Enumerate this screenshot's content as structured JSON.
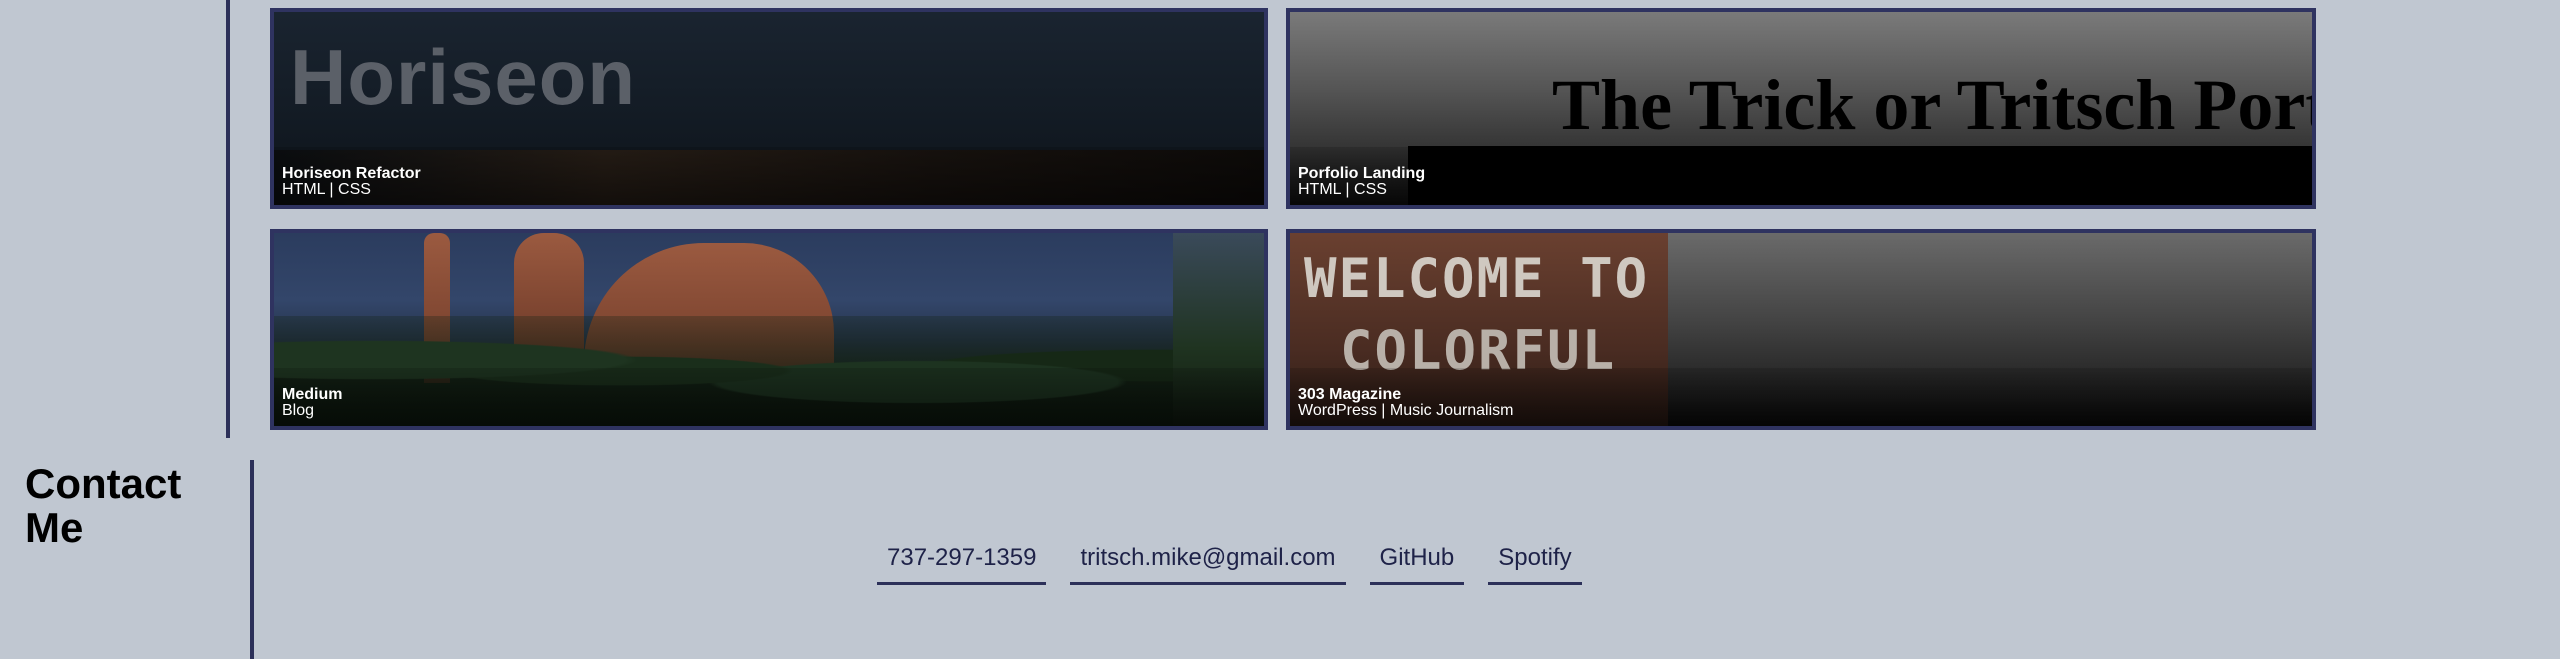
{
  "projects": [
    {
      "title": "Horiseon Refactor",
      "tags": "HTML | CSS",
      "thumb_text": "Horiseon"
    },
    {
      "title": "Porfolio Landing",
      "tags": "HTML | CSS",
      "thumb_text": "The Trick or Tritsch Port"
    },
    {
      "title": "Medium",
      "tags": "Blog"
    },
    {
      "title": "303 Magazine",
      "tags": "WordPress | Music Journalism",
      "thumb_text_line1": "WELCOME TO",
      "thumb_text_line2": "COLORFUL"
    }
  ],
  "contact": {
    "heading": "Contact Me",
    "links": [
      {
        "label": "737-297-1359"
      },
      {
        "label": "tritsch.mike@gmail.com"
      },
      {
        "label": "GitHub"
      },
      {
        "label": "Spotify"
      }
    ]
  },
  "colors": {
    "background": "#c0c7d1",
    "accent": "#2c3059",
    "link_text": "#1e2248"
  }
}
